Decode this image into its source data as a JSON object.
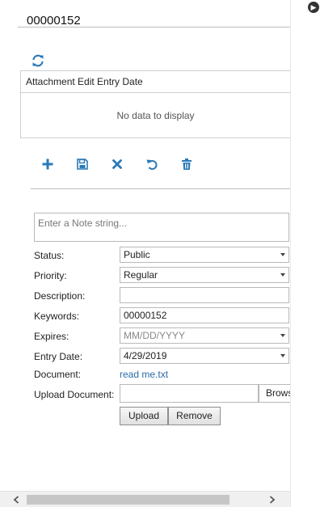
{
  "record": {
    "id": "00000152"
  },
  "attachments_grid": {
    "columns": [
      "Attachment Edit Entry Date"
    ],
    "empty_text": "No data to display"
  },
  "toolbar": {
    "add_icon": "plus-icon",
    "save_icon": "floppy-disk-icon",
    "delete_icon": "x-icon",
    "undo_icon": "undo-icon",
    "trash_icon": "trash-icon",
    "refresh_icon": "refresh-icon"
  },
  "form": {
    "note_placeholder": "Enter a Note string...",
    "status": {
      "label": "Status:",
      "value": "Public"
    },
    "priority": {
      "label": "Priority:",
      "value": "Regular"
    },
    "description": {
      "label": "Description:",
      "value": ""
    },
    "keywords": {
      "label": "Keywords:",
      "value": "00000152"
    },
    "expires": {
      "label": "Expires:",
      "placeholder": "MM/DD/YYYY"
    },
    "entry_date": {
      "label": "Entry Date:",
      "value": "4/29/2019"
    },
    "document": {
      "label": "Document:",
      "value": "read me.txt"
    },
    "upload_document": {
      "label": "Upload Document:",
      "browse_label": "Browse..."
    },
    "upload_button": "Upload",
    "remove_button": "Remove"
  },
  "colors": {
    "accent": "#2a7ab8",
    "link": "#2a6aa8"
  }
}
